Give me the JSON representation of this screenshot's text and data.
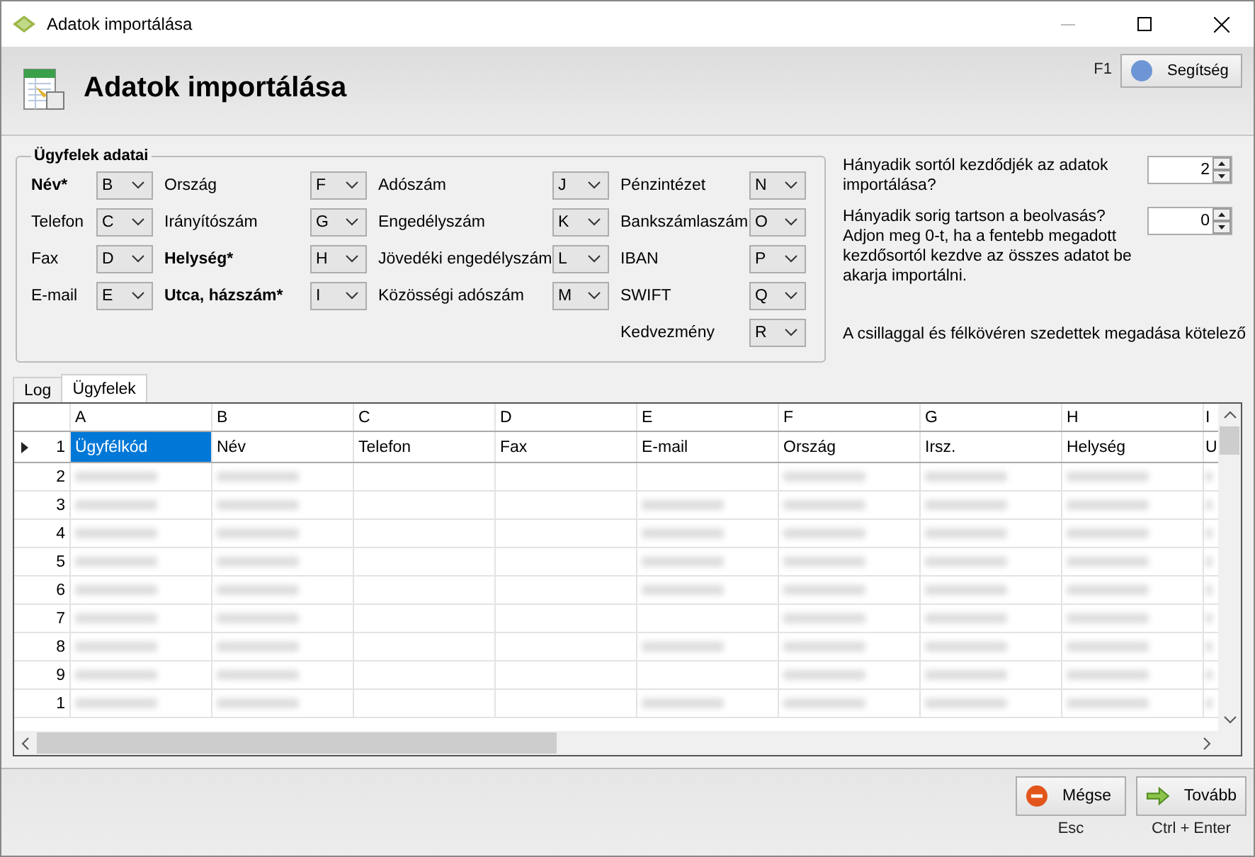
{
  "window": {
    "title": "Adatok importálása"
  },
  "header": {
    "title": "Adatok importálása",
    "help_shortcut": "F1",
    "help_button": "Segítség"
  },
  "group": {
    "title": "Ügyfelek adatai",
    "columns": [
      [
        {
          "label": "Név*",
          "value": "B",
          "required": true
        },
        {
          "label": "Telefon",
          "value": "C",
          "required": false
        },
        {
          "label": "Fax",
          "value": "D",
          "required": false
        },
        {
          "label": "E-mail",
          "value": "E",
          "required": false
        }
      ],
      [
        {
          "label": "Ország",
          "value": "F",
          "required": false
        },
        {
          "label": "Irányítószám",
          "value": "G",
          "required": false
        },
        {
          "label": "Helység*",
          "value": "H",
          "required": true
        },
        {
          "label": "Utca, házszám*",
          "value": "I",
          "required": true
        }
      ],
      [
        {
          "label": "Adószám",
          "value": "J",
          "required": false
        },
        {
          "label": "Engedélyszám",
          "value": "K",
          "required": false
        },
        {
          "label": "Jövedéki engedélyszám",
          "value": "L",
          "required": false
        },
        {
          "label": "Közösségi adószám",
          "value": "M",
          "required": false
        }
      ],
      [
        {
          "label": "Pénzintézet",
          "value": "N",
          "required": false
        },
        {
          "label": "Bankszámlaszám",
          "value": "O",
          "required": false
        },
        {
          "label": "IBAN",
          "value": "P",
          "required": false
        },
        {
          "label": "SWIFT",
          "value": "Q",
          "required": false
        },
        {
          "label": "Kedvezmény",
          "value": "R",
          "required": false
        }
      ]
    ]
  },
  "spinners": [
    {
      "label": "Hányadik sortól kezdődjék az adatok importálása?",
      "value": "2"
    },
    {
      "label": "Hányadik sorig tartson a beolvasás? Adjon meg 0-t, ha a fentebb megadott kezdősortól kezdve az összes adatot be akarja importálni.",
      "value": "0"
    }
  ],
  "note": "A csillaggal és félkövéren szedettek megadása kötelező",
  "tabs": [
    {
      "label": "Log",
      "selected": false
    },
    {
      "label": "Ügyfelek",
      "selected": true
    }
  ],
  "grid": {
    "columns": [
      "A",
      "B",
      "C",
      "D",
      "E",
      "F",
      "G",
      "H",
      "I"
    ],
    "header_row": {
      "number": "1",
      "current": true,
      "cells": [
        {
          "text": "Ügyfélkód",
          "selected": true
        },
        {
          "text": "Név",
          "selected": false
        },
        {
          "text": "Telefon",
          "selected": false
        },
        {
          "text": "Fax",
          "selected": false
        },
        {
          "text": "E-mail",
          "selected": false
        },
        {
          "text": "Ország",
          "selected": false
        },
        {
          "text": "Irsz.",
          "selected": false
        },
        {
          "text": "Helység",
          "selected": false
        },
        {
          "text": "U",
          "selected": false
        }
      ]
    },
    "rows": [
      {
        "number": "2",
        "blurred": [
          true,
          true,
          false,
          false,
          false,
          true,
          true,
          true,
          true
        ]
      },
      {
        "number": "3",
        "blurred": [
          true,
          true,
          false,
          false,
          true,
          true,
          true,
          true,
          true
        ]
      },
      {
        "number": "4",
        "blurred": [
          true,
          true,
          false,
          false,
          true,
          true,
          true,
          true,
          true
        ]
      },
      {
        "number": "5",
        "blurred": [
          true,
          true,
          false,
          false,
          true,
          true,
          true,
          true,
          true
        ]
      },
      {
        "number": "6",
        "blurred": [
          true,
          true,
          false,
          false,
          true,
          true,
          true,
          true,
          true
        ]
      },
      {
        "number": "7",
        "blurred": [
          true,
          true,
          false,
          false,
          false,
          true,
          true,
          true,
          true
        ]
      },
      {
        "number": "8",
        "blurred": [
          true,
          true,
          false,
          false,
          true,
          true,
          true,
          true,
          true
        ]
      },
      {
        "number": "9",
        "blurred": [
          true,
          true,
          false,
          false,
          false,
          true,
          true,
          true,
          true
        ]
      },
      {
        "number": "1",
        "blurred": [
          true,
          true,
          false,
          false,
          true,
          true,
          true,
          true,
          true
        ]
      }
    ]
  },
  "buttons": [
    {
      "kind": "cancel",
      "label": "Mégse",
      "shortcut": "Esc"
    },
    {
      "kind": "next",
      "label": "Tovább",
      "shortcut": "Ctrl + Enter"
    }
  ]
}
